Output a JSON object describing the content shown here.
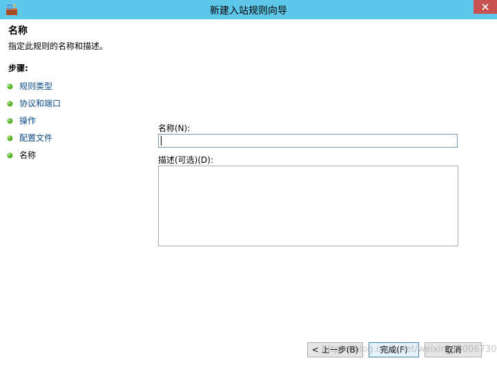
{
  "window": {
    "title": "新建入站规则向导",
    "icon": "firewall-wizard-icon",
    "close_icon": "close-icon",
    "titlebar_color": "#5fc8ea",
    "close_color": "#c75050"
  },
  "header": {
    "title": "名称",
    "subtitle": "指定此规则的名称和描述。"
  },
  "steps": {
    "label": "步骤:",
    "items": [
      {
        "label": "规则类型",
        "current": false
      },
      {
        "label": "协议和端口",
        "current": false
      },
      {
        "label": "操作",
        "current": false
      },
      {
        "label": "配置文件",
        "current": false
      },
      {
        "label": "名称",
        "current": true
      }
    ],
    "dot_color": "#5cb531"
  },
  "form": {
    "name_label": "名称(N):",
    "name_value": "",
    "description_label": "描述(可选)(D):",
    "description_value": ""
  },
  "buttons": {
    "back": "< 上一步(B)",
    "finish": "完成(F)",
    "cancel": "取消"
  },
  "watermark": "https://blog.csdn.net/weixin_38006730"
}
